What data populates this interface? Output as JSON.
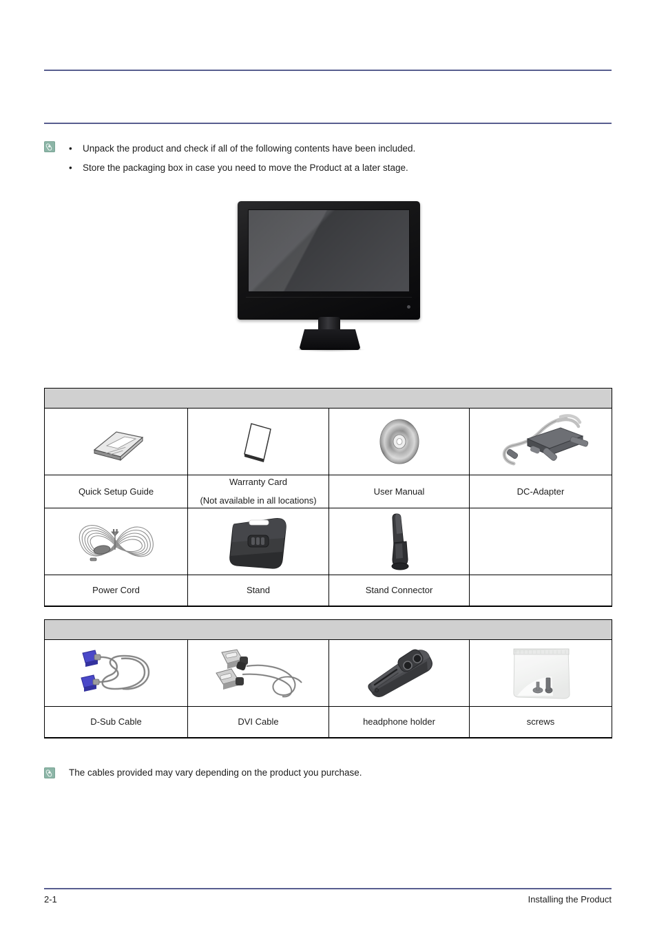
{
  "notes": {
    "top": {
      "icon": "note-icon",
      "bullets": [
        "Unpack the product and check if all of the following contents have been included.",
        "Store the packaging box in case you need to move the Product at a later stage."
      ],
      "bullet_mark": "•"
    },
    "bottom": {
      "icon": "note-icon",
      "text": "The cables provided may vary depending on the product you purchase."
    }
  },
  "hero": {
    "name": "lcd-monitor-product-image"
  },
  "tables": [
    {
      "id": "package-contents-table",
      "header_label": "",
      "rows": [
        {
          "cells": [
            {
              "icon": "quick-setup-guide-icon",
              "label": "Quick Setup Guide",
              "sublabel": ""
            },
            {
              "icon": "warranty-card-icon",
              "label": "Warranty Card",
              "sublabel": "(Not available in all locations)"
            },
            {
              "icon": "user-manual-cd-icon",
              "label": "User Manual",
              "sublabel": ""
            },
            {
              "icon": "dc-adapter-icon",
              "label": "DC-Adapter",
              "sublabel": ""
            }
          ]
        },
        {
          "cells": [
            {
              "icon": "power-cord-icon",
              "label": "Power Cord",
              "sublabel": ""
            },
            {
              "icon": "stand-icon",
              "label": "Stand",
              "sublabel": ""
            },
            {
              "icon": "stand-connector-icon",
              "label": "Stand Connector",
              "sublabel": ""
            },
            {
              "icon": "",
              "label": "",
              "sublabel": ""
            }
          ]
        }
      ]
    },
    {
      "id": "cables-table",
      "header_label": "",
      "rows": [
        {
          "cells": [
            {
              "icon": "d-sub-cable-icon",
              "label": "D-Sub Cable",
              "sublabel": ""
            },
            {
              "icon": "dvi-cable-icon",
              "label": "DVI Cable",
              "sublabel": ""
            },
            {
              "icon": "headphone-holder-icon",
              "label": "headphone holder",
              "sublabel": ""
            },
            {
              "icon": "screws-bag-icon",
              "label": "screws",
              "sublabel": ""
            }
          ]
        }
      ]
    }
  ],
  "footer": {
    "page_number": "2-1",
    "section_title": "Installing the Product"
  },
  "colors": {
    "rule": "#575d8f",
    "table_header_fill": "#d0d0d0",
    "table_border": "#000000",
    "note_icon_fill": "#8cb5a7",
    "connector_blue": "#4a48c8",
    "text": "#1c1c1c"
  }
}
